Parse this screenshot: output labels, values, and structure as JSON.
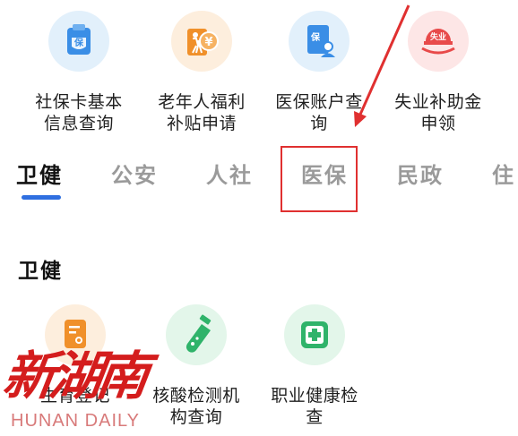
{
  "services_top": [
    {
      "label": "社保卡基本信息查询",
      "icon": "social-card-icon",
      "color": "#3a8ee6"
    },
    {
      "label": "老年人福利补贴申请",
      "icon": "elderly-subsidy-icon",
      "color": "#f0902a"
    },
    {
      "label": "医保账户查询",
      "icon": "medical-insurance-doc-icon",
      "color": "#3a8ee6"
    },
    {
      "label": "失业补助金申领",
      "icon": "unemployment-benefit-icon",
      "color": "#e84a4a"
    }
  ],
  "services_top_lines": [
    [
      "社保卡基本",
      "信息查询"
    ],
    [
      "老年人福利",
      "补贴申请"
    ],
    [
      "医保账户查",
      "询"
    ],
    [
      "失业补助金",
      "申领"
    ]
  ],
  "tabs": [
    "卫健",
    "公安",
    "人社",
    "医保",
    "民政",
    "住"
  ],
  "active_tab": "卫健",
  "section": {
    "title": "卫健"
  },
  "services_section_lines": [
    [
      "生育登记"
    ],
    [
      "核酸检测机",
      "构查询"
    ],
    [
      "职业健康检",
      "查"
    ]
  ],
  "services_section": [
    {
      "label": "生育登记",
      "icon": "birth-registration-icon",
      "color": "#f0902a"
    },
    {
      "label": "核酸检测机构查询",
      "icon": "test-tube-icon",
      "color": "#2fb36a"
    },
    {
      "label": "职业健康检查",
      "icon": "medical-kit-icon",
      "color": "#2fb36a"
    }
  ],
  "watermark": {
    "cn": "新湖南",
    "en": "HUNAN DAILY"
  },
  "icon_badges": {
    "card": "保",
    "doc": "保",
    "unemploy": "失业",
    "coin": "¥"
  },
  "colors": {
    "accent": "#2f6fe0",
    "annotation": "#e03030"
  }
}
